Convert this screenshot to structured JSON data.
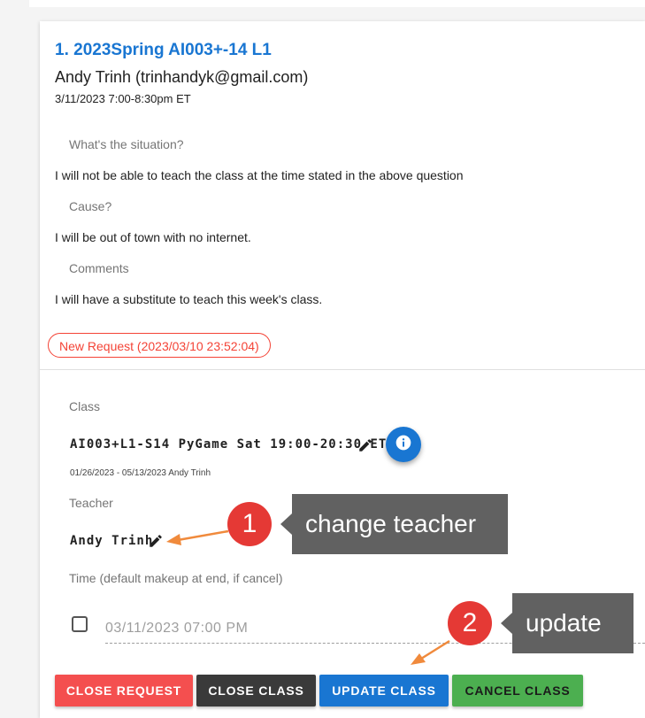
{
  "request": {
    "title": "1. 2023Spring AI003+-14 L1",
    "student": "Andy Trinh (trinhandyk@gmail.com)",
    "datetime": "3/11/2023 7:00-8:30pm ET",
    "questions": [
      {
        "label": "What's the situation?",
        "answer": "I will not be able to teach the class at the time stated in the above question"
      },
      {
        "label": "Cause?",
        "answer": "I will be out of town with no internet."
      },
      {
        "label": "Comments",
        "answer": "I will have a substitute to teach this week's class."
      }
    ],
    "status_chip": "New Request (2023/03/10 23:52:04)"
  },
  "form": {
    "class_label": "Class",
    "class_name": "AI003+L1-S14 PyGame Sat 19:00-20:30 ET",
    "class_sub": "01/26/2023 - 05/13/2023 Andy Trinh",
    "teacher_label": "Teacher",
    "teacher_name": "Andy Trinh",
    "time_label": "Time (default makeup at end, if cancel)",
    "time_value": "03/11/2023 07:00 PM"
  },
  "buttons": {
    "close_request": "CLOSE REQUEST",
    "close_class": "CLOSE CLASS",
    "update_class": "UPDATE CLASS",
    "cancel_class": "CANCEL CLASS"
  },
  "annotations": [
    {
      "number": "1",
      "text": "change teacher"
    },
    {
      "number": "2",
      "text": "update"
    }
  ],
  "icons": {
    "edit": "pencil-icon",
    "info": "info-icon",
    "checkbox": "checkbox-outline-icon"
  },
  "colors": {
    "primary": "#1976d2",
    "danger": "#f44f4f",
    "dark": "#3a3a3a",
    "success": "#4caf50",
    "badge": "#e53935",
    "callout": "#616161",
    "arrow": "#f08a3c"
  }
}
